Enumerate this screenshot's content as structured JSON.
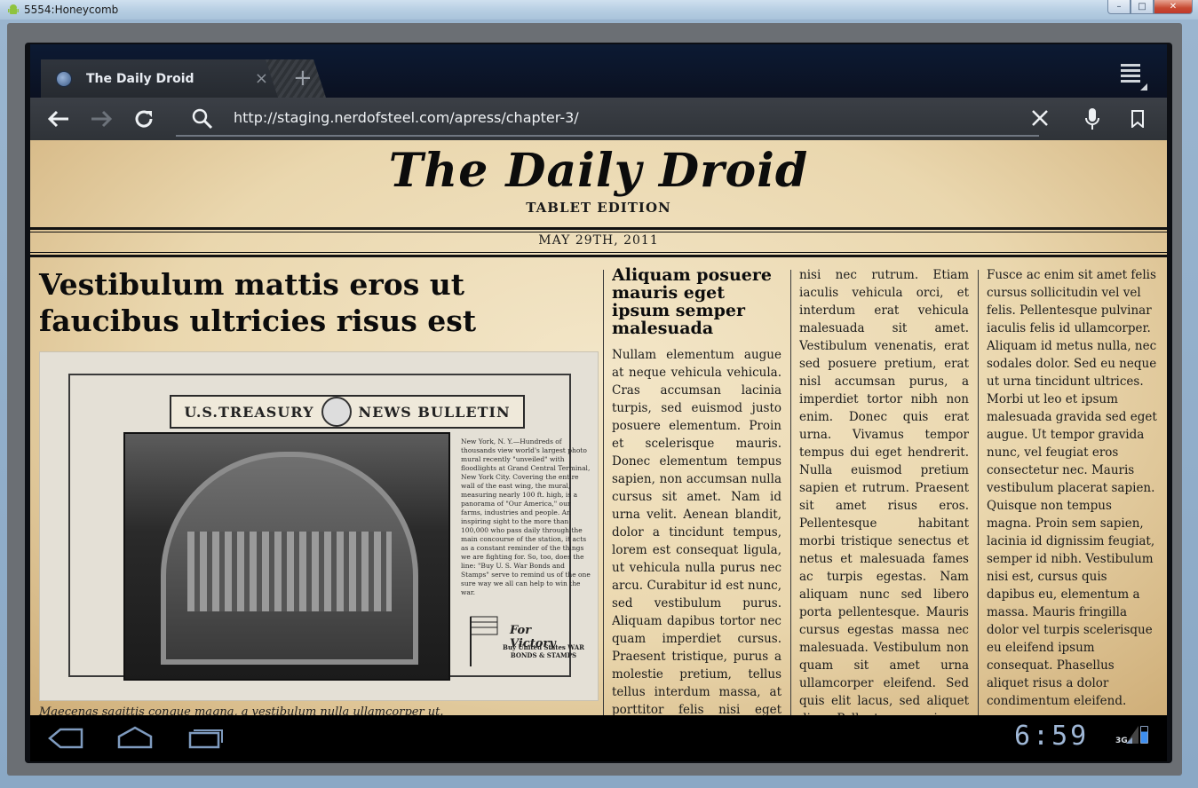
{
  "window": {
    "title": "5554:Honeycomb",
    "controls": {
      "minimize": "–",
      "maximize": "□",
      "close": "✕"
    }
  },
  "browser": {
    "tab": {
      "title": "The Daily Droid",
      "close": "×"
    },
    "new_tab": "+",
    "url": "http://staging.nerdofsteel.com/apress/chapter-3/"
  },
  "page": {
    "paper_title": "The Daily Droid",
    "edition": "TABLET EDITION",
    "date": "MAY 29TH, 2011",
    "headline": "Vestibulum mattis eros ut faucibus ultricies risus est",
    "photo": {
      "banner_left": "U.S.TREASURY",
      "banner_right": "NEWS BULLETIN",
      "bulletin_text": "New York, N. Y.—Hundreds of thousands view world's largest photo mural recently \"unveiled\" with floodlights at Grand Central Terminal, New York City. Covering the entire wall of the east wing, the mural, measuring nearly 100 ft. high, is a panorama of \"Our America,\" our farms, industries and people. An inspiring sight to the more than 100,000 who pass daily through the main concourse of the station, it acts as a constant reminder of the things we are fighting for. So, too, does the line: \"Buy U. S. War Bonds and Stamps\" serve to remind us of the one sure way we all can help to win the war.",
      "victory": "For Victory",
      "victory_sub": "Buy United States WAR BONDS & STAMPS"
    },
    "caption": "Maecenas sagittis congue magna, a vestibulum nulla ullamcorper ut.",
    "col1_heading": "Aliquam posuere mauris eget ipsum semper malesuada",
    "col1_text": "Nullam elementum augue at neque vehicula vehicula. Cras accumsan lacinia turpis, sed euismod justo posuere elementum. Proin et scelerisque mauris. Donec elementum tempus sapien, non accumsan nulla cursus sit amet. Nam id urna velit. Aenean blandit, dolor a tincidunt tempus, lorem est consequat ligula, ut vehicula nulla purus nec arcu. Curabitur id est nunc, sed vestibulum purus. Aliquam dapibus tortor nec quam imperdiet cursus. Praesent tristique, purus a molestie pretium, tellus tellus interdum massa, at porttitor felis nisi eget arcu.",
    "col2_text": "nisi nec rutrum. Etiam iaculis vehicula orci, et interdum erat vehicula malesuada sit amet. Vestibulum venenatis, erat sed posuere pretium, erat nisl accumsan purus, a imperdiet tortor nibh non enim. Donec quis erat urna. Vivamus tempor tempus dui eget hendrerit. Nulla euismod pretium sapien et rutrum. Praesent sit amet risus eros. Pellentesque habitant morbi tristique senectus et netus et malesuada fames ac turpis egestas. Nam aliquam nunc sed libero porta pellentesque. Mauris cursus egestas massa nec malesuada. Vestibulum non quam sit amet urna ullamcorper eleifend. Sed quis elit lacus, sed aliquet diam. Pellentesque quis",
    "col3_text": "Fusce ac enim sit amet felis cursus sollicitudin vel vel felis. Pellentesque pulvinar iaculis felis id ullamcorper. Aliquam id metus nulla, nec sodales dolor. Sed eu neque ut urna tincidunt ultrices. Morbi ut leo et ipsum malesuada gravida sed eget augue. Ut tempor gravida nunc, vel feugiat eros consectetur nec. Mauris vestibulum placerat sapien. Quisque non tempus magna. Proin sem sapien, lacinia id dignissim feugiat, semper id nibh. Vestibulum nisi est, cursus quis dapibus eu, elementum a massa. Mauris fringilla dolor vel turpis scelerisque eu eleifend ipsum consequat. Phasellus aliquet risus a dolor condimentum eleifend. Praesent ut"
  },
  "system": {
    "clock": "6:59",
    "network": "3G"
  }
}
